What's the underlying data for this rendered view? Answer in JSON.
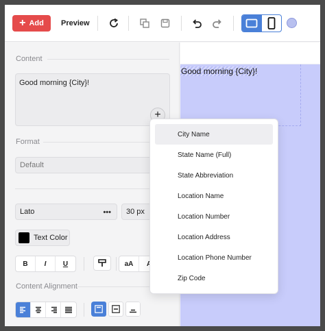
{
  "toolbar": {
    "add_label": "Add",
    "preview_label": "Preview",
    "icons": [
      "refresh-icon",
      "duplicate-icon",
      "save-icon",
      "undo-icon",
      "redo-icon",
      "desktop-icon",
      "mobile-icon"
    ]
  },
  "panel": {
    "content_label": "Content",
    "content_value": "Good morning {City}!",
    "format_label": "Format",
    "format_value": "Default",
    "font_value": "Lato",
    "font_more": "•••",
    "size_value": "30 px",
    "text_color_label": "Text Color",
    "text_color": "#000000",
    "style_buttons": [
      "B",
      "I",
      "U"
    ],
    "case_buttons": [
      "aA",
      "A"
    ],
    "alignment_label": "Content Alignment"
  },
  "canvas": {
    "text": "Good morning {City}!",
    "background": "#c8ccfb"
  },
  "menu": {
    "items": [
      "City Name",
      "State Name (Full)",
      "State Abbreviation",
      "Location Name",
      "Location Number",
      "Location Address",
      "Location Phone Number",
      "Zip Code"
    ]
  },
  "colors": {
    "accent": "#4a80d8",
    "add_button": "#e54b4b"
  }
}
